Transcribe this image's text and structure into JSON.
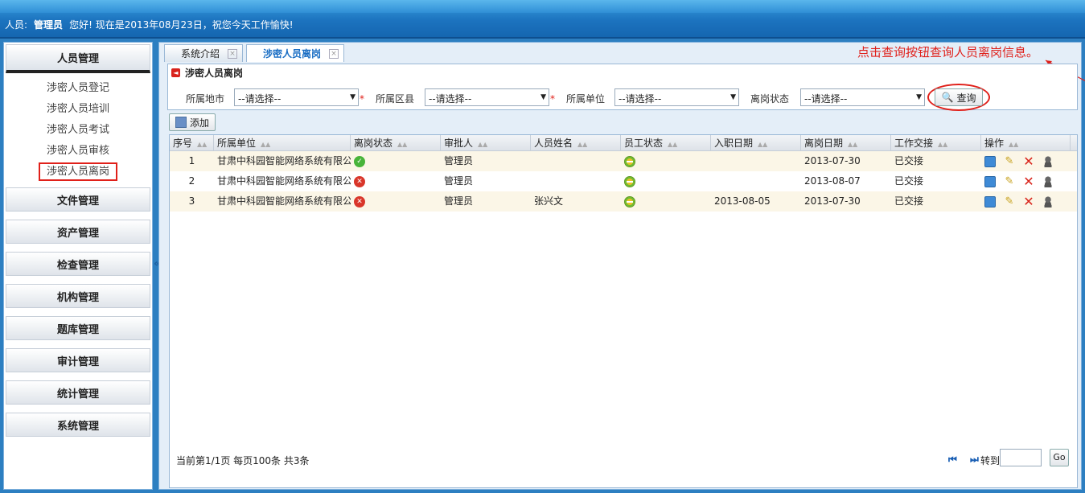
{
  "header": {
    "user_label": "人员:",
    "user_name": "管理员",
    "greeting": "您好!  现在是2013年08月23日，祝您今天工作愉快!"
  },
  "sidebar": {
    "active_group": "人员管理",
    "sub_items": [
      "涉密人员登记",
      "涉密人员培训",
      "涉密人员考试",
      "涉密人员审核",
      "涉密人员离岗"
    ],
    "groups": [
      "文件管理",
      "资产管理",
      "检查管理",
      "机构管理",
      "题库管理",
      "审计管理",
      "统计管理",
      "系统管理"
    ],
    "collapse": "«"
  },
  "tabs": [
    {
      "label": "系统介绍",
      "close": "×"
    },
    {
      "label": "涉密人员离岗",
      "close": "×"
    }
  ],
  "annotation": "点击查询按钮查询人员离岗信息。",
  "panel": {
    "title": "涉密人员离岗",
    "filters": [
      {
        "label": "所属地市",
        "value": "--请选择--",
        "required": "*"
      },
      {
        "label": "所属区县",
        "value": "--请选择--",
        "required": "*"
      },
      {
        "label": "所属单位",
        "value": "--请选择--"
      },
      {
        "label": "离岗状态",
        "value": "--请选择--"
      }
    ],
    "search_label": "查询"
  },
  "add_label": "添加",
  "grid": {
    "columns": [
      "序号",
      "所属单位",
      "离岗状态",
      "审批人",
      "人员姓名",
      "员工状态",
      "入职日期",
      "离岗日期",
      "工作交接",
      "操作"
    ],
    "rows": [
      {
        "idx": "1",
        "unit": "甘肃中科园智能网络系统有限公",
        "leave_status": "ok",
        "approver": "管理员",
        "name": "",
        "emp_status": "minus",
        "join_date": "",
        "leave_date": "2013-07-30",
        "handover": "已交接"
      },
      {
        "idx": "2",
        "unit": "甘肃中科园智能网络系统有限公",
        "leave_status": "no",
        "approver": "管理员",
        "name": "",
        "emp_status": "minus",
        "join_date": "",
        "leave_date": "2013-08-07",
        "handover": "已交接"
      },
      {
        "idx": "3",
        "unit": "甘肃中科园智能网络系统有限公",
        "leave_status": "no",
        "approver": "管理员",
        "name": "张兴文",
        "emp_status": "minus",
        "join_date": "2013-08-05",
        "leave_date": "2013-07-30",
        "handover": "已交接"
      }
    ]
  },
  "pager": {
    "info": "当前第1/1页  每页100条  共3条",
    "first_prev": "⏮ ⏭",
    "goto_label": "转到",
    "go_label": "Go"
  }
}
